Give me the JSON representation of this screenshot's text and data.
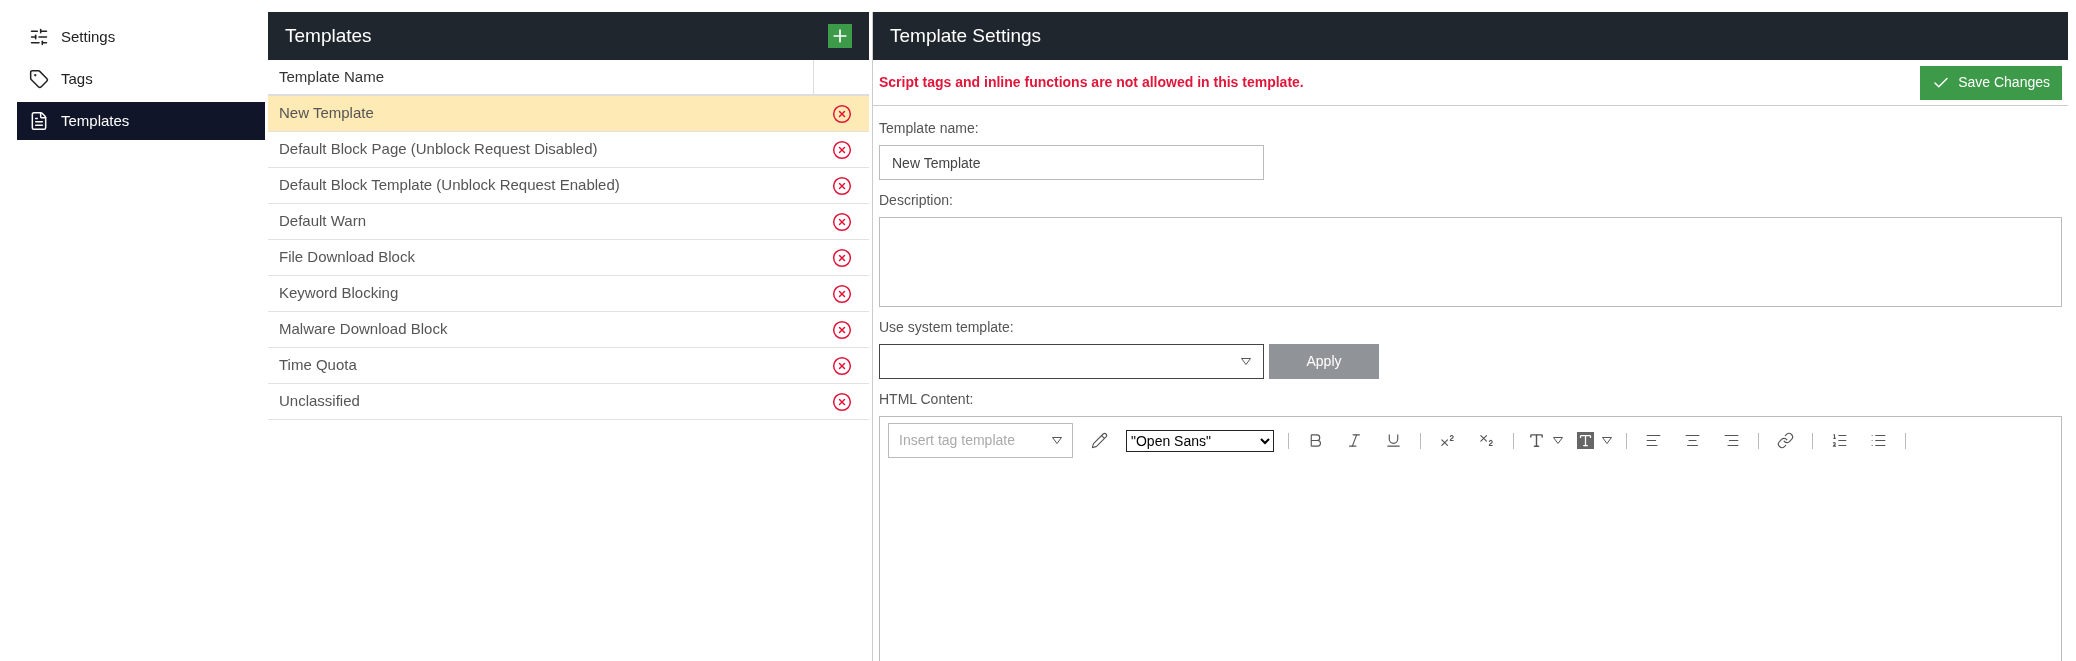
{
  "sidebar": {
    "items": [
      {
        "label": "Settings",
        "selected": false
      },
      {
        "label": "Tags",
        "selected": false
      },
      {
        "label": "Templates",
        "selected": true
      }
    ]
  },
  "templates": {
    "title": "Templates",
    "column": "Template Name",
    "rows": [
      {
        "name": "New Template",
        "selected": true
      },
      {
        "name": "Default Block Page (Unblock Request Disabled)",
        "selected": false
      },
      {
        "name": "Default Block Template (Unblock Request Enabled)",
        "selected": false
      },
      {
        "name": "Default Warn",
        "selected": false
      },
      {
        "name": "File Download Block",
        "selected": false
      },
      {
        "name": "Keyword Blocking",
        "selected": false
      },
      {
        "name": "Malware Download Block",
        "selected": false
      },
      {
        "name": "Time Quota",
        "selected": false
      },
      {
        "name": "Unclassified",
        "selected": false
      }
    ]
  },
  "settings": {
    "title": "Template Settings",
    "warning": "Script tags and inline functions are not allowed in this template.",
    "save": "Save Changes",
    "name_label": "Template name:",
    "name_value": "New Template",
    "description_label": "Description:",
    "system_label": "Use system template:",
    "apply": "Apply",
    "html_label": "HTML Content:",
    "tag_placeholder": "Insert tag template",
    "font": "\"Open Sans\""
  }
}
